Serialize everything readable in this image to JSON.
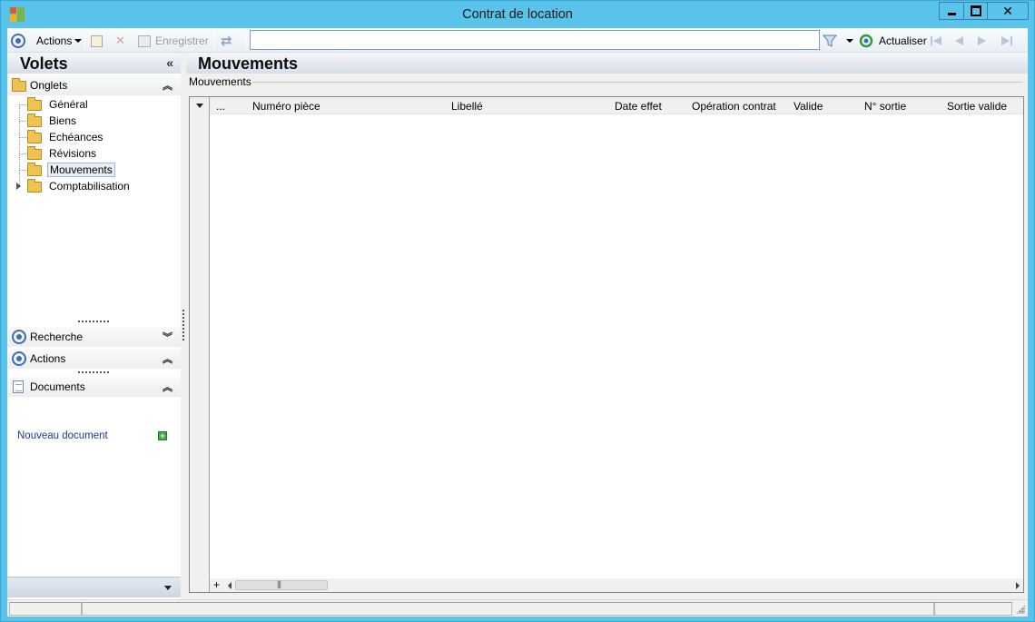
{
  "window": {
    "title": "Contrat de location"
  },
  "toolbar": {
    "actions_label": "Actions",
    "save_label": "Enregistrer",
    "search_value": "",
    "refresh_label": "Actualiser"
  },
  "left_pane": {
    "title": "Volets",
    "onglets_label": "Onglets",
    "tree_items": [
      {
        "label": "Général"
      },
      {
        "label": "Biens"
      },
      {
        "label": "Echéances"
      },
      {
        "label": "Révisions"
      },
      {
        "label": "Mouvements"
      },
      {
        "label": "Comptabilisation"
      }
    ],
    "selected_item": "Mouvements",
    "recherche_label": "Recherche",
    "actions_label": "Actions",
    "documents_label": "Documents",
    "new_document_label": "Nouveau document"
  },
  "main": {
    "title": "Mouvements",
    "group_label": "Mouvements",
    "grid": {
      "columns": [
        "...",
        "Numéro pièce",
        "Libellé",
        "Date effet",
        "Opération contrat",
        "Valide",
        "N° sortie",
        "Sortie valide"
      ],
      "rows": []
    }
  },
  "colors": {
    "title_bar": "#59c3ec",
    "accent_blue": "#3b6db3",
    "link_blue": "#1f3a8f"
  }
}
